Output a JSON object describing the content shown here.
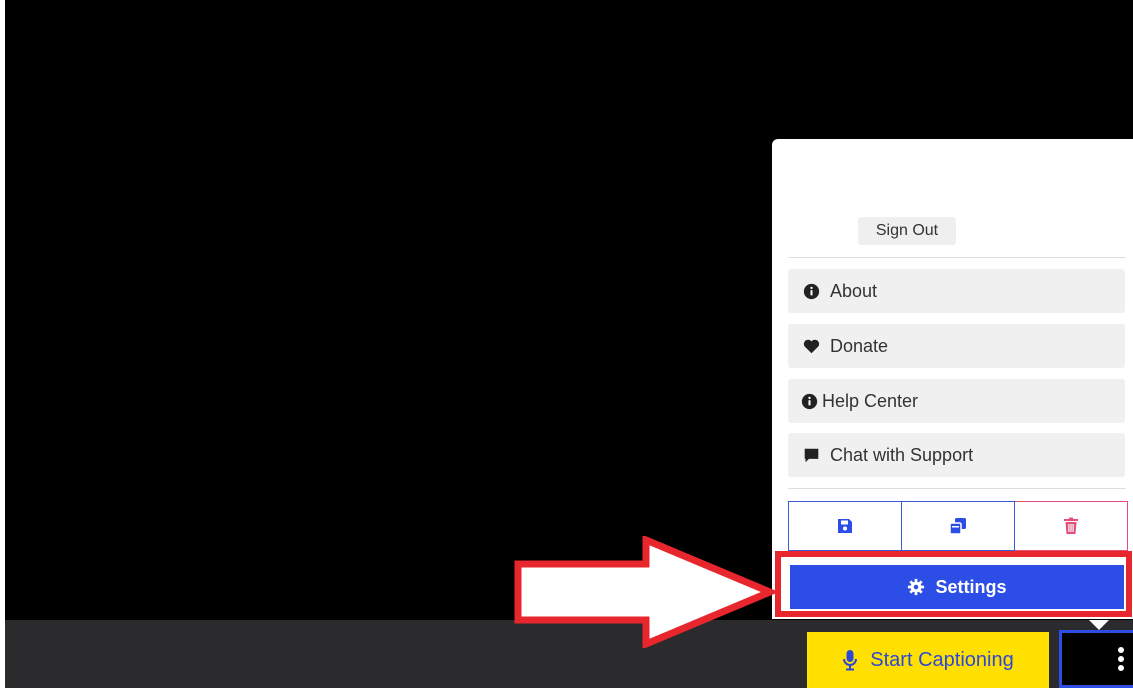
{
  "menu": {
    "sign_out_label": "Sign Out",
    "items": [
      {
        "label": "About",
        "icon": "info-circle-icon"
      },
      {
        "label": "Donate",
        "icon": "heart-icon"
      },
      {
        "label": "Help Center",
        "icon": "info-circle-icon"
      },
      {
        "label": "Chat with Support",
        "icon": "chat-bubble-icon"
      }
    ],
    "actions": [
      {
        "icon": "save-icon"
      },
      {
        "icon": "copy-icon"
      },
      {
        "icon": "trash-icon"
      }
    ],
    "settings_label": "Settings"
  },
  "bottombar": {
    "start_captioning_label": "Start Captioning"
  },
  "colors": {
    "accent_blue": "#2d4ee6",
    "highlight_red": "#e8262d",
    "start_yellow": "#ffe000",
    "delete_red": "#e0507a"
  }
}
